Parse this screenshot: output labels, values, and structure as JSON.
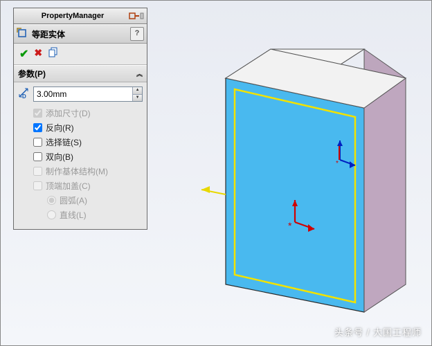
{
  "header": {
    "title": "PropertyManager"
  },
  "command": {
    "title": "等距实体"
  },
  "params": {
    "section_label": "参数(P)",
    "distance": "3.00mm",
    "add_dimensions": "添加尺寸(D)",
    "reverse": "反向(R)",
    "select_chain": "选择链(S)",
    "bidirectional": "双向(B)",
    "construction": "制作基体结构(M)",
    "cap_ends": "顶端加盖(C)",
    "arc": "圆弧(A)",
    "line": "直线(L)"
  },
  "watermark": "头条号 / 大国工程师"
}
